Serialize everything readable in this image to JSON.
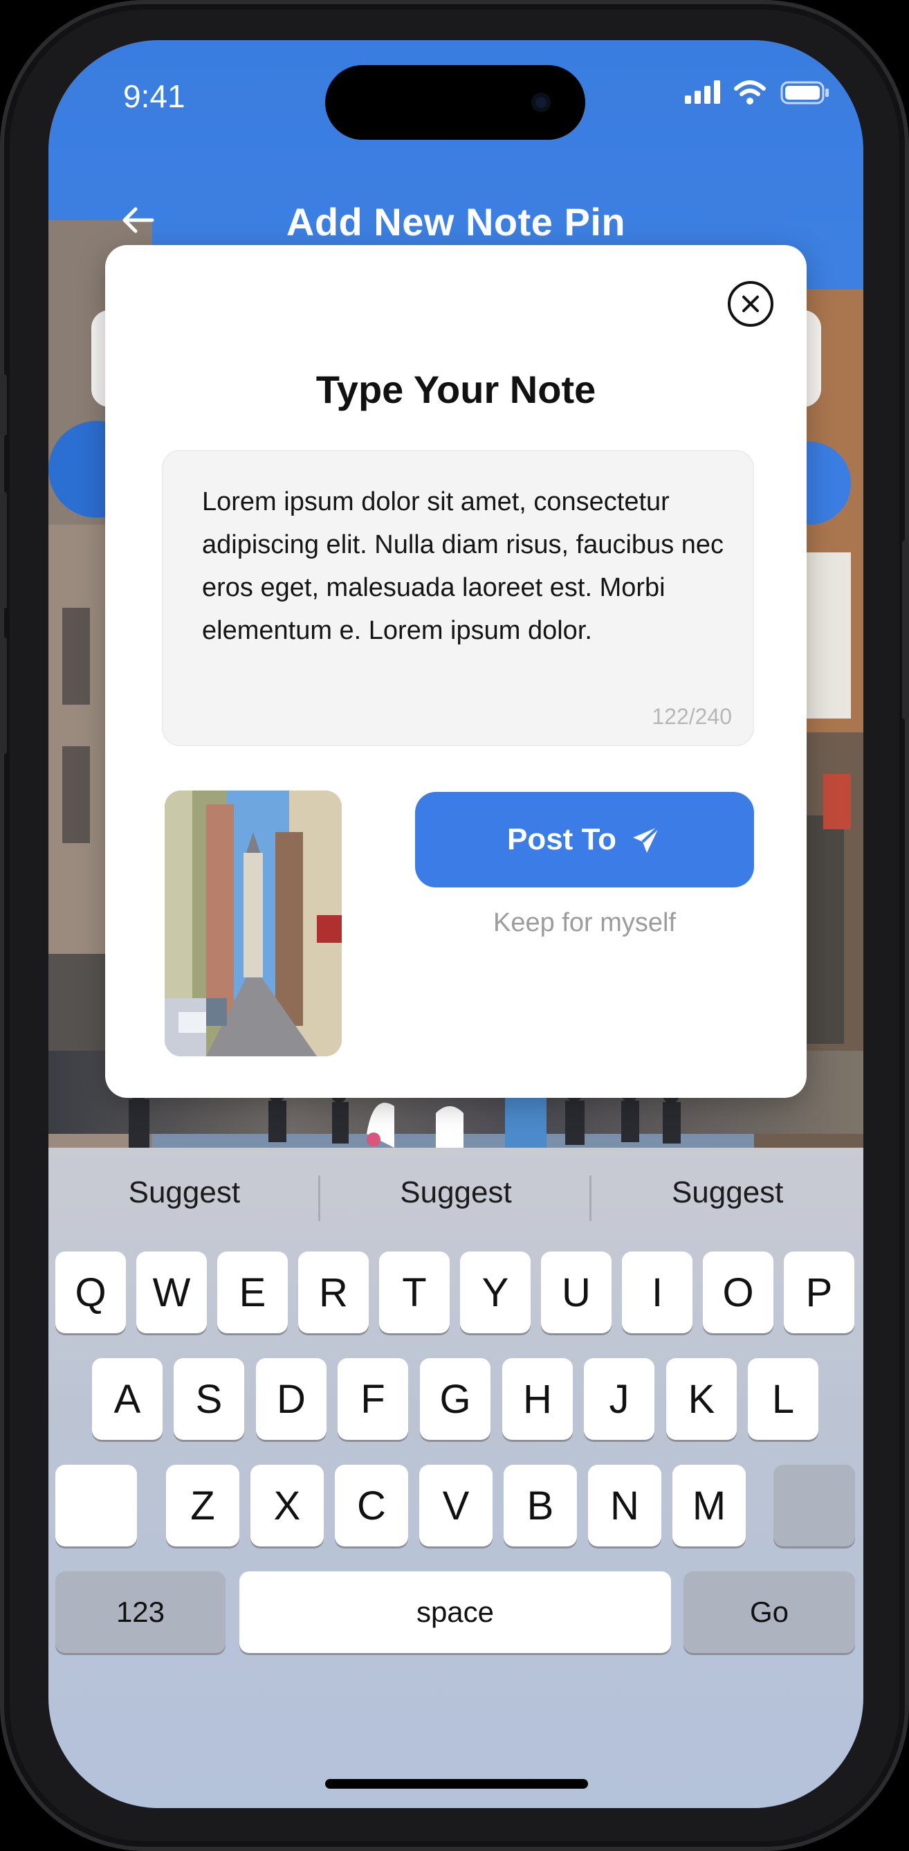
{
  "status_bar": {
    "time": "9:41"
  },
  "header": {
    "title": "Add New Note Pin"
  },
  "modal": {
    "title": "Type Your Note",
    "note_text": "Lorem ipsum dolor sit amet, consectetur adipiscing elit. Nulla diam risus, faucibus nec eros eget, malesuada laoreet est. Morbi elementum e. Lorem ipsum dolor.",
    "counter": "122/240",
    "post_label": "Post To",
    "keep_label": "Keep for myself"
  },
  "keyboard": {
    "suggestions": [
      "Suggest",
      "Suggest",
      "Suggest"
    ],
    "row1": [
      "Q",
      "W",
      "E",
      "R",
      "T",
      "Y",
      "U",
      "I",
      "O",
      "P"
    ],
    "row2": [
      "A",
      "S",
      "D",
      "F",
      "G",
      "H",
      "J",
      "K",
      "L"
    ],
    "row3": [
      "Z",
      "X",
      "C",
      "V",
      "B",
      "N",
      "M"
    ],
    "numbers_label": "123",
    "space_label": "space",
    "go_label": "Go"
  },
  "colors": {
    "accent": "#3c7ce6",
    "sky": "#3a7de0"
  },
  "icons": [
    "back-arrow-icon",
    "close-icon",
    "send-icon",
    "signal-icon",
    "wifi-icon",
    "battery-icon"
  ]
}
